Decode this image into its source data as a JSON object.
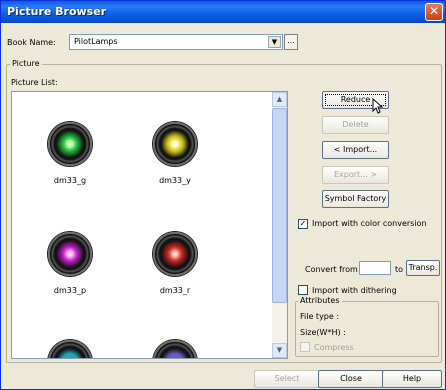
{
  "window": {
    "title": "Picture Browser",
    "close_glyph": "✕"
  },
  "book": {
    "label": "Book Name:",
    "value": "PilotLamps",
    "browse_label": "..."
  },
  "picture_group": {
    "title": "Picture",
    "list_label": "Picture List:"
  },
  "pictures": [
    {
      "name": "dm33_g",
      "color": "#1fae3a",
      "glow": "#9dff8f"
    },
    {
      "name": "dm33_y",
      "color": "#c9c21c",
      "glow": "#fff7a0"
    },
    {
      "name": "dm33_p",
      "color": "#b21ab8",
      "glow": "#ff9cf7"
    },
    {
      "name": "dm33_r",
      "color": "#b5231f",
      "glow": "#ff9a8a"
    }
  ],
  "partial_pictures": [
    {
      "color": "#23a8b8"
    },
    {
      "color": "#6a5cc8"
    }
  ],
  "buttons": {
    "reduce": "Reduce",
    "delete": "Delete",
    "import": "< Import...",
    "export": "Export... >",
    "symbol_factory": "Symbol Factory"
  },
  "options": {
    "import_color_conversion": "Import with color conversion",
    "import_color_conversion_checked": true,
    "convert_from": "Convert from",
    "convert_to": "to",
    "transp": "Transp.",
    "import_dithering": "Import with dithering",
    "import_dithering_checked": false
  },
  "attributes": {
    "title": "Attributes",
    "file_type": "File type :",
    "size": "Size(W*H) :",
    "compress": "Compress"
  },
  "footer": {
    "select": "Select",
    "close": "Close",
    "help": "Help"
  },
  "icons": {
    "close": "close-icon",
    "dropdown": "chevron-down-icon",
    "scroll_up": "scroll-up-icon",
    "scroll_down": "scroll-down-icon",
    "cursor": "pointer-icon"
  }
}
